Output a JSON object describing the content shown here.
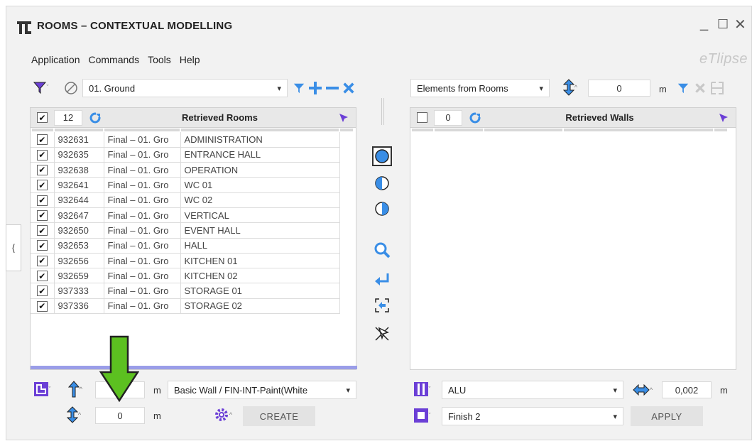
{
  "window": {
    "title": "ROOMS – CONTEXTUAL MODELLING",
    "brand": "eTlipse",
    "controls": {
      "minimize": "_",
      "maximize": "☐",
      "close": "✕"
    }
  },
  "menu": [
    "Application",
    "Commands",
    "Tools",
    "Help"
  ],
  "left": {
    "level_select": "01. Ground",
    "count": "12",
    "header_title": "Retrieved Rooms",
    "rows": [
      {
        "id": "932631",
        "level": "Final – 01. Gro",
        "name": "ADMINISTRATION"
      },
      {
        "id": "932635",
        "level": "Final – 01. Gro",
        "name": "ENTRANCE HALL"
      },
      {
        "id": "932638",
        "level": "Final – 01. Gro",
        "name": "OPERATION"
      },
      {
        "id": "932641",
        "level": "Final – 01. Gro",
        "name": "WC 01"
      },
      {
        "id": "932644",
        "level": "Final – 01. Gro",
        "name": "WC 02"
      },
      {
        "id": "932647",
        "level": "Final – 01. Gro",
        "name": "VERTICAL"
      },
      {
        "id": "932650",
        "level": "Final – 01. Gro",
        "name": "EVENT HALL"
      },
      {
        "id": "932653",
        "level": "Final – 01. Gro",
        "name": "HALL"
      },
      {
        "id": "932656",
        "level": "Final – 01. Gro",
        "name": "KITCHEN 01"
      },
      {
        "id": "932659",
        "level": "Final – 01. Gro",
        "name": "KITCHEN 02"
      },
      {
        "id": "937333",
        "level": "Final – 01. Gro",
        "name": "STORAGE 01"
      },
      {
        "id": "937336",
        "level": "Final – 01. Gro",
        "name": "STORAGE 02"
      }
    ],
    "bottom": {
      "unit1": "m",
      "wall_type": "Basic Wall / FIN-INT-Paint(White",
      "offset_value": "0",
      "unit2": "m",
      "create_label": "CREATE"
    }
  },
  "right": {
    "source_select": "Elements from Rooms",
    "offset_value": "0",
    "unit": "m",
    "count": "0",
    "header_title": "Retrieved Walls",
    "bottom": {
      "material": "ALU",
      "thickness": "0,002",
      "unit": "m",
      "finish": "Finish 2",
      "apply_label": "APPLY"
    }
  },
  "sidebar_toggle": "⟨",
  "colors": {
    "accent_blue": "#3a8ee6",
    "accent_purple": "#6b3fd6",
    "arrow_green": "#5cc020",
    "progress": "#9a9de8"
  }
}
